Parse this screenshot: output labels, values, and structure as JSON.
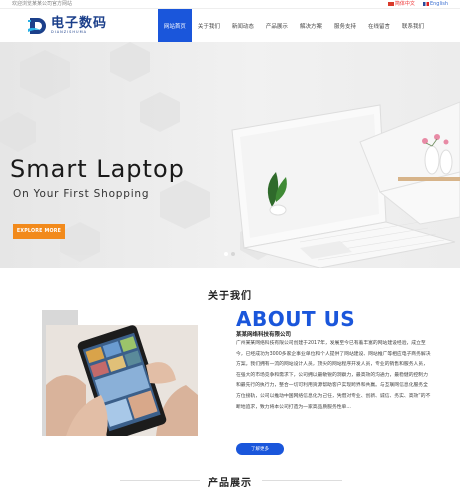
{
  "topbar": {
    "welcome": "欢迎浏览某某公司官方网站",
    "lang_cn": "简体中文",
    "lang_en": "English"
  },
  "logo": {
    "cn": "电子数码",
    "en": "DIANZISHUMA"
  },
  "nav": {
    "items": [
      "网站首页",
      "关于我们",
      "新闻动态",
      "产品展示",
      "解决方案",
      "服务支持",
      "在线留言",
      "联系我们"
    ]
  },
  "hero": {
    "title": "Smart Laptop",
    "subtitle": "On Your First Shopping",
    "button": "EXPLORE MORE"
  },
  "about": {
    "section_title": "关于我们",
    "heading": "ABOUT US",
    "company": "某某网络科技有限公司",
    "paragraph": "广州某某网络科技有限公司创建于2017年，发展至今已有着丰富的网站建设经验，成立至今，已经成功为3000多家企事业单位和个人提供了网站建设、网站推广等相应电子商务解决方案。我们拥有一流的网站设计人员，顶尖的网站程序开发人员，专业的销售和服务人员，在强大的市场竞争和需求下，公司拥以最敏锐的洞察力，最高效的沟通力，最稳健的控制力和最先行的执行力，整合一切可利用资源帮助客户实现跨界和共赢。与互联网信息化服务全方位接轨，公司以推动中国网络信息化为己任，凭借对专业、创新、诚信、务实、高效“的不断地追求，致力将本公司打造为一家高品质服务性单...",
    "button": "了解更多"
  },
  "products": {
    "section_title": "产品展示"
  },
  "colors": {
    "accent": "#1a56db",
    "hero_button": "#f28a1b"
  }
}
